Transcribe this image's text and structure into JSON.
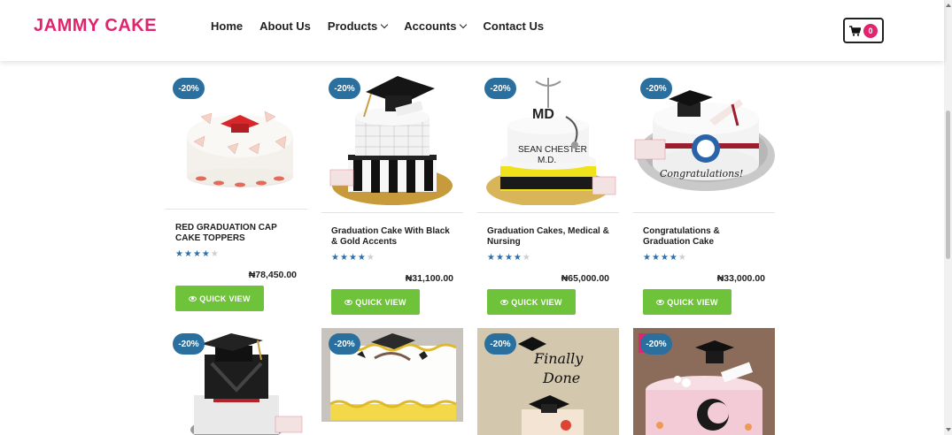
{
  "header": {
    "brand": "JAMMY CAKE",
    "nav": [
      "Home",
      "About Us",
      "Products",
      "Accounts",
      "Contact Us"
    ],
    "cart_count": "0"
  },
  "products": [
    {
      "badge": "-20%",
      "name": "RED GRADUATION CAP CAKE TOPPERS",
      "rating": 4,
      "price": "₦78,450.00",
      "quick_view": "QUICK VIEW"
    },
    {
      "badge": "-20%",
      "name": "Graduation Cake With Black & Gold Accents",
      "rating": 4,
      "price": "₦31,100.00",
      "quick_view": "QUICK VIEW"
    },
    {
      "badge": "-20%",
      "name": "Graduation Cakes, Medical & Nursing",
      "rating": 4,
      "price": "₦65,000.00",
      "quick_view": "QUICK VIEW"
    },
    {
      "badge": "-20%",
      "name": "Congratulations & Graduation Cake",
      "rating": 4,
      "price": "₦33,000.00",
      "quick_view": "QUICK VIEW"
    }
  ],
  "products_row2": [
    {
      "badge": "-20%"
    },
    {
      "badge": "-20%"
    },
    {
      "badge": "-20%"
    },
    {
      "badge": "-20%"
    }
  ],
  "colors": {
    "brand": "#e0246d",
    "badge": "#2a6f9e",
    "quick_view": "#6fc33a",
    "star": "#2f6fa5"
  }
}
